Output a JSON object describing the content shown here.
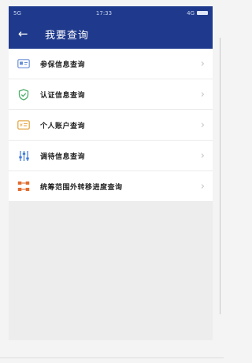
{
  "status_bar": {
    "left": "5G",
    "time": "17:33",
    "network": "4G"
  },
  "header": {
    "title": "我要查询"
  },
  "menu": [
    {
      "label": "参保信息查询",
      "icon": "id-card-icon",
      "color": "#6b8fd6"
    },
    {
      "label": "认证信息查询",
      "icon": "shield-check-icon",
      "color": "#4cae6b"
    },
    {
      "label": "个人账户查询",
      "icon": "account-card-icon",
      "color": "#e3a13a"
    },
    {
      "label": "调待信息查询",
      "icon": "sliders-icon",
      "color": "#3e78d8"
    },
    {
      "label": "统筹范围外转移进度查询",
      "icon": "transfer-icon",
      "color": "#e26b2f"
    }
  ],
  "colors": {
    "header_bg": "#1f3a8c",
    "page_bg": "#ededed"
  }
}
